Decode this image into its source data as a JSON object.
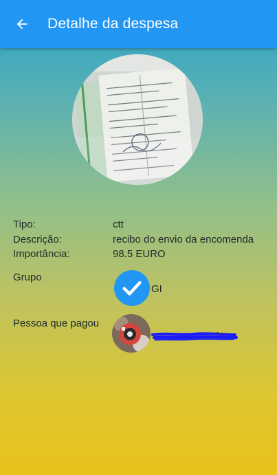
{
  "header": {
    "title": "Detalhe da despesa",
    "back_icon": "arrow-left-icon"
  },
  "receipt": {
    "image": "receipt-photo"
  },
  "details": {
    "type_label": "Tipo:",
    "type_value": "ctt",
    "description_label": "Descrição:",
    "description_value": "recibo do envio da encomenda",
    "amount_label": "Importância:",
    "amount_value": "98.5 EURO"
  },
  "group": {
    "label": "Grupo",
    "name": "GI",
    "icon": "check-icon"
  },
  "payer": {
    "label": "Pessoa que pagou",
    "avatar": "avatar-photo"
  },
  "colors": {
    "appbar": "#2196f3",
    "check_circle": "#2196f3",
    "gradient_top": "#2ba3cc",
    "gradient_bottom": "#e9c21c",
    "redaction": "#1a1aff"
  }
}
